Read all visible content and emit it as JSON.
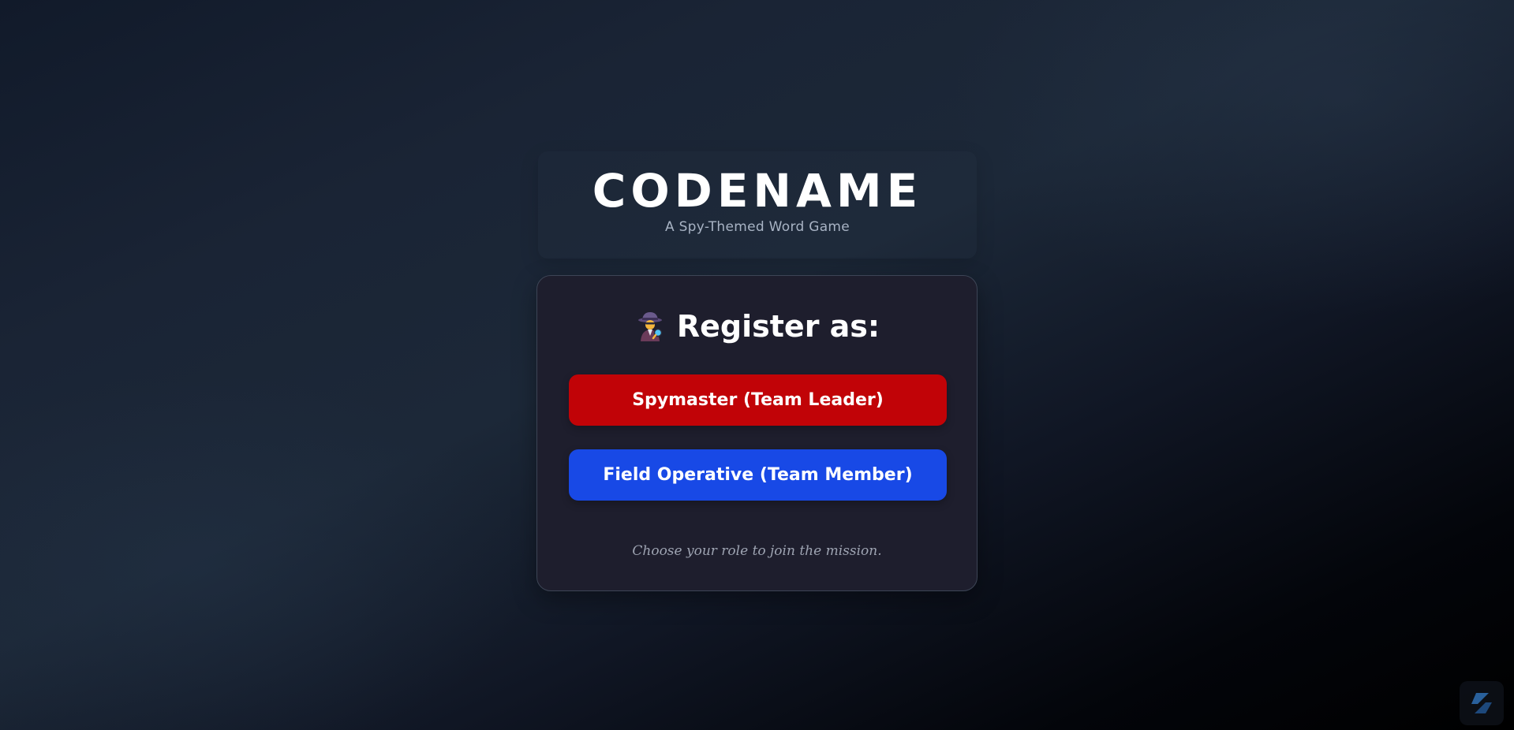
{
  "header": {
    "title": "CODENAME",
    "subtitle": "A Spy-Themed Word Game"
  },
  "register": {
    "icon": "detective-icon",
    "heading": "Register as:",
    "buttons": {
      "spymaster": "Spymaster (Team Leader)",
      "operative": "Field Operative (Team Member)"
    },
    "hint": "Choose your role to join the mission."
  },
  "corner_widget": {
    "icon": "app-logo-icon"
  },
  "colors": {
    "spymaster_button": "#c10307",
    "operative_button": "#1849e6",
    "card_background": "#1e1e2d"
  }
}
